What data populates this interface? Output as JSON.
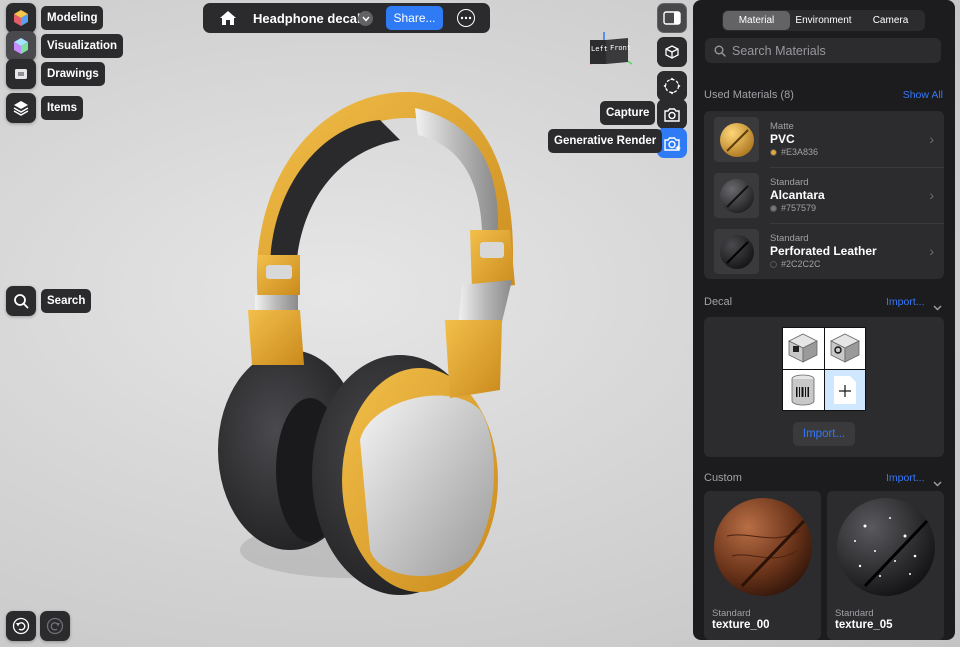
{
  "left_tools": {
    "modeling": "Modeling",
    "visualization": "Visualization",
    "drawings": "Drawings",
    "items": "Items",
    "search": "Search"
  },
  "topbar": {
    "title": "Headphone decal",
    "share": "Share..."
  },
  "view_cube": {
    "left": "Left",
    "front": "Front"
  },
  "right_tools": {
    "capture": "Capture",
    "generative_render": "Generative Render"
  },
  "panel": {
    "tabs": [
      {
        "label": "Material",
        "active": true
      },
      {
        "label": "Environment",
        "active": false
      },
      {
        "label": "Camera",
        "active": false
      }
    ],
    "search_placeholder": "Search Materials",
    "used_title": "Used Materials (8)",
    "show_all": "Show All",
    "materials": [
      {
        "type": "Matte",
        "name": "PVC",
        "hex": "#E3A836",
        "color": "#E3A836"
      },
      {
        "type": "Standard",
        "name": "Alcantara",
        "hex": "#757579",
        "color": "#757579"
      },
      {
        "type": "Standard",
        "name": "Perforated Leather",
        "hex": "#2C2C2C",
        "color": "#2C2C2C"
      }
    ],
    "decal_title": "Decal",
    "decal_import_link": "Import...",
    "decal_import_button": "Import...",
    "custom_title": "Custom",
    "custom_import_link": "Import...",
    "custom": [
      {
        "type": "Standard",
        "name": "texture_00"
      },
      {
        "type": "Standard",
        "name": "texture_05"
      }
    ]
  },
  "colors": {
    "accent": "#3478F6",
    "headphone_yellow": "#E3A836",
    "panel_bg": "#1C1C1E"
  }
}
